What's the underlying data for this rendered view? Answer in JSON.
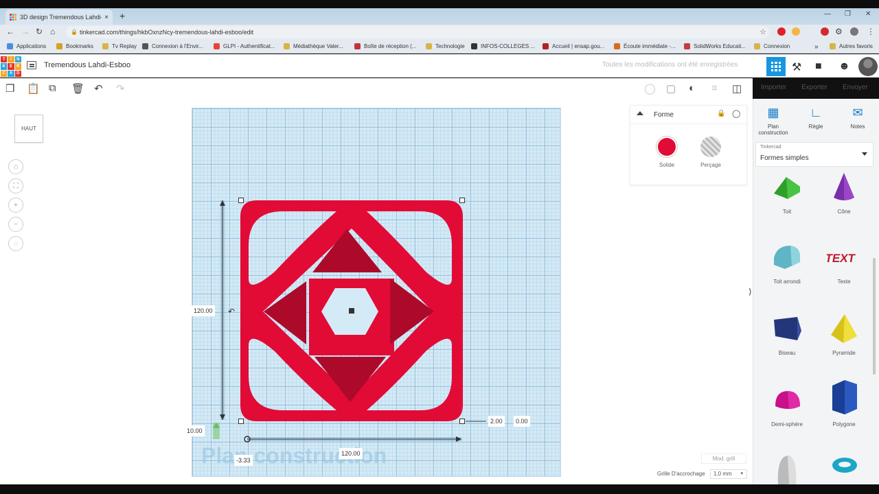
{
  "browser": {
    "tab_title": "3D design Tremendous Lahdi-Es",
    "tab_close": "×",
    "new_tab": "+",
    "url": "tinkercad.com/things/hkbOxnzNcy-tremendous-lahdi-esboo/edit",
    "bookmarks": [
      "Applications",
      "Bookmarks",
      "Tv Replay",
      "Connexion à l'Envir...",
      "GLPI - Authentificat...",
      "Médiathèque Valer...",
      "Boîte de réception (...",
      "Technologie",
      "INFOS-COLLEGES ...",
      "Accueil | ensap.gou...",
      "Écoute immédiate -...",
      "SolidWorks Educati...",
      "Connexion"
    ],
    "other_bookmarks": "Autres favoris",
    "bookmark_colors": [
      "#4a8fdc",
      "#d6a021",
      "#d9b34a",
      "#555555",
      "#ea4335",
      "#d9b34a",
      "#c2323b",
      "#d9b34a",
      "#333333",
      "#b22222",
      "#d96b1a",
      "#c73b3b",
      "#d9b34a"
    ]
  },
  "header": {
    "logo_letters": [
      "TIN",
      "KER",
      "CAD"
    ],
    "title": "Tremendous Lahdi-Esboo",
    "save_status": "Toutes les modifications ont été enregistrées"
  },
  "toolbar": {
    "import_label": "Importer",
    "export_label": "Exporter",
    "send_label": "Envoyer"
  },
  "viewport": {
    "view_cube_label": "HAUT",
    "workplane_label": "Plan construction",
    "dimensions": {
      "height": "120.00",
      "width": "120.00",
      "elevation": "10.00",
      "right_offset": "2.00",
      "right_value": "0.00",
      "origin_offset": "-3.33"
    },
    "shape_color": "#e20b36",
    "shape_dark": "#b10a2b"
  },
  "inspector": {
    "title": "Forme",
    "solid_label": "Solide",
    "hole_label": "Perçage",
    "solid_color": "#e20b36"
  },
  "sidebar": {
    "tools": [
      "Plan construction",
      "Règle",
      "Notes"
    ],
    "library_header": "Tinkercad",
    "library_value": "Formes simples",
    "shapes": [
      "Toit",
      "Cône",
      "Toit arrondi",
      "Texte",
      "Biseau",
      "Pyramide",
      "Demi-sphère",
      "Polygone"
    ]
  },
  "bottom": {
    "edit_grid": "Mod. grill",
    "snap_label": "Grille D'accrochage",
    "snap_value": "1,0 mm"
  }
}
